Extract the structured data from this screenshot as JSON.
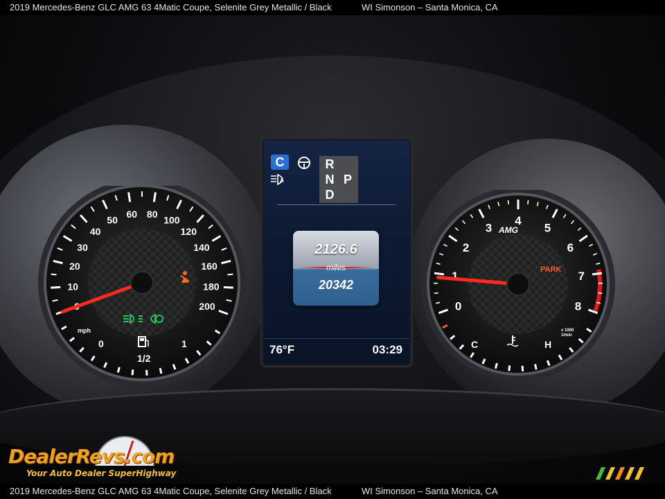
{
  "caption": {
    "vehicle": "2019 Mercedes-Benz GLC AMG 63 4Matic Coupe,  Selenite Grey Metallic / Black",
    "dealer": "WI Simonson – Santa Monica, CA"
  },
  "speedometer": {
    "ticks": [
      "0",
      "10",
      "20",
      "30",
      "40",
      "50",
      "60",
      "80",
      "100",
      "120",
      "140",
      "160",
      "180",
      "200"
    ],
    "unit": "mph",
    "fuel_empty": "0",
    "fuel_half": "1/2",
    "fuel_full": "1",
    "needle_value_mph": 0
  },
  "tachometer": {
    "ticks": [
      "0",
      "1",
      "2",
      "3",
      "4",
      "5",
      "6",
      "7",
      "8"
    ],
    "brand": "AMG",
    "park_label": "PARK",
    "unit_label": "x 1000\n1/min",
    "temp_cold": "C",
    "temp_hot": "H",
    "needle_value_rpm_x1000": 0.9
  },
  "center_display": {
    "drive_mode": "C",
    "gears": [
      "R",
      "N",
      "P",
      "D"
    ],
    "trip": "2126.6",
    "distance_unit": "miles",
    "odometer": "20342",
    "outside_temp": "76°F",
    "clock": "03:29"
  },
  "watermark": {
    "brand": "DealerRevs.com",
    "tagline": "Your Auto Dealer SuperHighway"
  },
  "colors": {
    "needle": "#ff2a1e",
    "accent_blue": "#2b6fd0",
    "indicator_green": "#22c55e",
    "warning_orange": "#ff6a1a"
  }
}
